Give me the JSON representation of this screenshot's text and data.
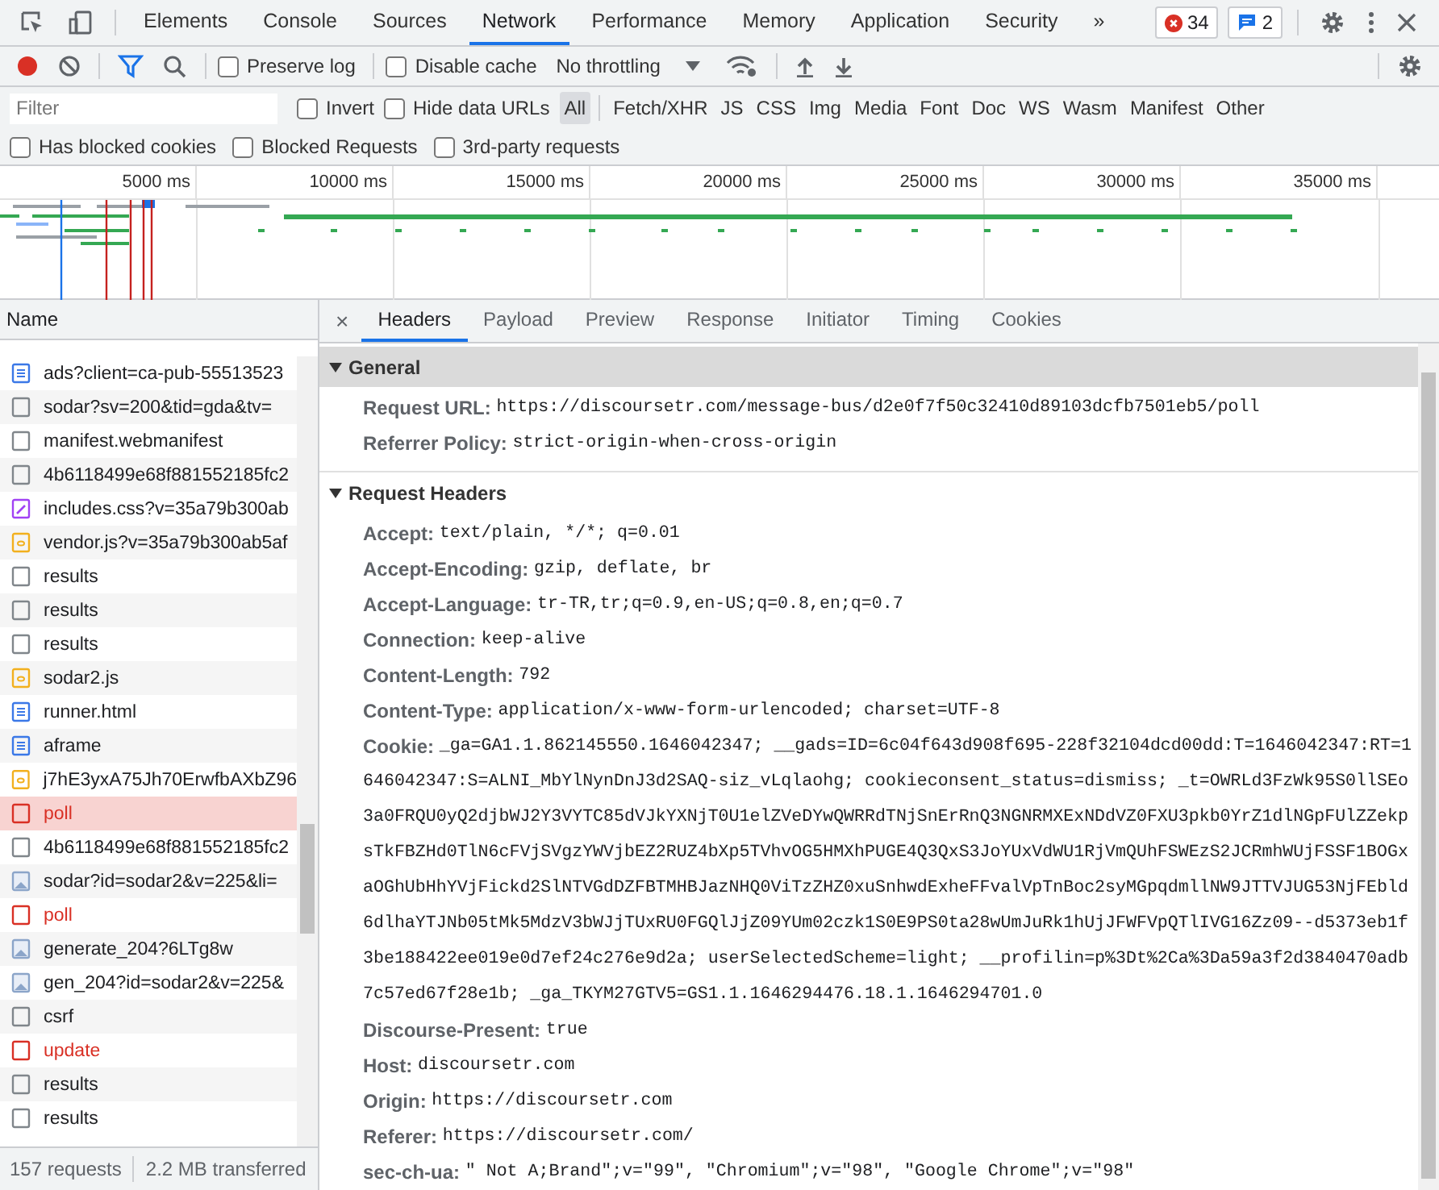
{
  "devtools_tabs": [
    {
      "label": "Elements",
      "selected": false
    },
    {
      "label": "Console",
      "selected": false
    },
    {
      "label": "Sources",
      "selected": false
    },
    {
      "label": "Network",
      "selected": true
    },
    {
      "label": "Performance",
      "selected": false
    },
    {
      "label": "Memory",
      "selected": false
    },
    {
      "label": "Application",
      "selected": false
    },
    {
      "label": "Security",
      "selected": false
    }
  ],
  "overflow": "»",
  "error_count": "34",
  "message_count": "2",
  "toolbar": {
    "recording": true,
    "filter_on": true,
    "preserve_log": {
      "label": "Preserve log",
      "checked": false
    },
    "disable_cache": {
      "label": "Disable cache",
      "checked": false
    },
    "throttling": "No throttling"
  },
  "filter_bar": {
    "placeholder": "Filter",
    "invert": {
      "label": "Invert",
      "checked": false
    },
    "hide_data_urls": {
      "label": "Hide data URLs",
      "checked": false
    },
    "types": [
      {
        "label": "All",
        "selected": true
      },
      {
        "label": "Fetch/XHR",
        "selected": false
      },
      {
        "label": "JS",
        "selected": false
      },
      {
        "label": "CSS",
        "selected": false
      },
      {
        "label": "Img",
        "selected": false
      },
      {
        "label": "Media",
        "selected": false
      },
      {
        "label": "Font",
        "selected": false
      },
      {
        "label": "Doc",
        "selected": false
      },
      {
        "label": "WS",
        "selected": false
      },
      {
        "label": "Wasm",
        "selected": false
      },
      {
        "label": "Manifest",
        "selected": false
      },
      {
        "label": "Other",
        "selected": false
      }
    ]
  },
  "blocked_row": [
    {
      "label": "Has blocked cookies",
      "checked": false
    },
    {
      "label": "Blocked Requests",
      "checked": false
    },
    {
      "label": "3rd-party requests",
      "checked": false
    }
  ],
  "overview": {
    "ticks": [
      "5000 ms",
      "10000 ms",
      "15000 ms",
      "20000 ms",
      "25000 ms",
      "30000 ms",
      "35000 ms"
    ]
  },
  "requests": {
    "column": "Name",
    "rows": [
      {
        "name": "ads?client=ca-pub-55513523",
        "kind": "doc",
        "error": false,
        "selected": false
      },
      {
        "name": "sodar?sv=200&tid=gda&tv=",
        "kind": "other",
        "error": false,
        "selected": false
      },
      {
        "name": "manifest.webmanifest",
        "kind": "other",
        "error": false,
        "selected": false
      },
      {
        "name": "4b6118499e68f881552185fc2",
        "kind": "other",
        "error": false,
        "selected": false
      },
      {
        "name": "includes.css?v=35a79b300ab",
        "kind": "css",
        "error": false,
        "selected": false
      },
      {
        "name": "vendor.js?v=35a79b300ab5af",
        "kind": "js",
        "error": false,
        "selected": false
      },
      {
        "name": "results",
        "kind": "other",
        "error": false,
        "selected": false
      },
      {
        "name": "results",
        "kind": "other",
        "error": false,
        "selected": false
      },
      {
        "name": "results",
        "kind": "other",
        "error": false,
        "selected": false
      },
      {
        "name": "sodar2.js",
        "kind": "js",
        "error": false,
        "selected": false
      },
      {
        "name": "runner.html",
        "kind": "doc",
        "error": false,
        "selected": false
      },
      {
        "name": "aframe",
        "kind": "doc",
        "error": false,
        "selected": false
      },
      {
        "name": "j7hE3yxA75Jh70ErwfbAXbZ96",
        "kind": "js",
        "error": false,
        "selected": false
      },
      {
        "name": "poll",
        "kind": "other",
        "error": true,
        "selected": true
      },
      {
        "name": "4b6118499e68f881552185fc2",
        "kind": "other",
        "error": false,
        "selected": false
      },
      {
        "name": "sodar?id=sodar2&v=225&li=",
        "kind": "img",
        "error": false,
        "selected": false
      },
      {
        "name": "poll",
        "kind": "other",
        "error": true,
        "selected": false
      },
      {
        "name": "generate_204?6LTg8w",
        "kind": "img",
        "error": false,
        "selected": false
      },
      {
        "name": "gen_204?id=sodar2&v=225&",
        "kind": "img",
        "error": false,
        "selected": false
      },
      {
        "name": "csrf",
        "kind": "other",
        "error": false,
        "selected": false
      },
      {
        "name": "update",
        "kind": "other",
        "error": true,
        "selected": false
      },
      {
        "name": "results",
        "kind": "other",
        "error": false,
        "selected": false
      },
      {
        "name": "results",
        "kind": "other",
        "error": false,
        "selected": false
      }
    ]
  },
  "status_bar": {
    "requests": "157 requests",
    "transferred": "2.2 MB transferred"
  },
  "details": {
    "close": "×",
    "tabs": [
      {
        "label": "Headers",
        "selected": true
      },
      {
        "label": "Payload",
        "selected": false
      },
      {
        "label": "Preview",
        "selected": false
      },
      {
        "label": "Response",
        "selected": false
      },
      {
        "label": "Initiator",
        "selected": false
      },
      {
        "label": "Timing",
        "selected": false
      },
      {
        "label": "Cookies",
        "selected": false
      }
    ],
    "sections": [
      {
        "title": "General",
        "expanded": true,
        "rows": [
          {
            "name": "Request URL:",
            "value": "https://discoursetr.com/message-bus/d2e0f7f50c32410d89103dcfb7501eb5/poll"
          },
          {
            "name": "Referrer Policy:",
            "value": "strict-origin-when-cross-origin"
          }
        ]
      },
      {
        "title": "Request Headers",
        "expanded": true,
        "rows": [
          {
            "name": "Accept:",
            "value": "text/plain, */*; q=0.01"
          },
          {
            "name": "Accept-Encoding:",
            "value": "gzip, deflate, br"
          },
          {
            "name": "Accept-Language:",
            "value": "tr-TR,tr;q=0.9,en-US;q=0.8,en;q=0.7"
          },
          {
            "name": "Connection:",
            "value": "keep-alive"
          },
          {
            "name": "Content-Length:",
            "value": "792"
          },
          {
            "name": "Content-Type:",
            "value": "application/x-www-form-urlencoded; charset=UTF-8"
          },
          {
            "name": "Cookie:",
            "value": "_ga=GA1.1.862145550.1646042347; __gads=ID=6c04f643d908f695-228f32104dcd00dd:T=1646042347:RT=1646042347:S=ALNI_MbYlNynDnJ3d2SAQ-siz_vLqlaohg; cookieconsent_status=dismiss; _t=OWRLd3FzWk95S0llSEo3a0FRQU0yQ2djbWJ2Y3VYTC85dVJkYXNjT0U1elZVeDYwQWRRdTNjSnErRnQ3NGNRMXExNDdVZ0FXU3pkb0YrZ1dlNGpFUlZZekpsTkFBZHd0TlN6cFVjSVgzYWVjbEZ2RUZ4bXp5TVhvOG5HMXhPUGE4Q3QxS3JoYUxVdWU1RjVmQUhFSWEzS2JCRmhWUjFSSF1BOGxaOGhUbHhYVjFickd2SlNTVGdDZFBTMHBJazNHQ0ViTzZHZ0xuSnhwdExheFFvalVpTnBoc2syMGpqdmllNW9JTTVJUG53NjFEbld6dlhaYTJNb05tMk5MdzV3bWJjTUxRU0FGQlJjZ09YUm02czk1S0E9PS0ta28wUmJuRk1hUjJFWFVpQTlIVG16Zz09--d5373eb1f3be188422ee019e0d7ef24c276e9d2a; userSelectedScheme=light; __profilin=p%3Dt%2Ca%3Da59a3f2d3840470adb7c57ed67f28e1b; _ga_TKYM27GTV5=GS1.1.1646294476.18.1.1646294701.0"
          },
          {
            "name": "Discourse-Present:",
            "value": "true"
          },
          {
            "name": "Host:",
            "value": "discoursetr.com"
          },
          {
            "name": "Origin:",
            "value": "https://discoursetr.com"
          },
          {
            "name": "Referer:",
            "value": "https://discoursetr.com/"
          },
          {
            "name": "sec-ch-ua:",
            "value": "\" Not A;Brand\";v=\"99\", \"Chromium\";v=\"98\", \"Google Chrome\";v=\"98\""
          }
        ]
      }
    ]
  }
}
